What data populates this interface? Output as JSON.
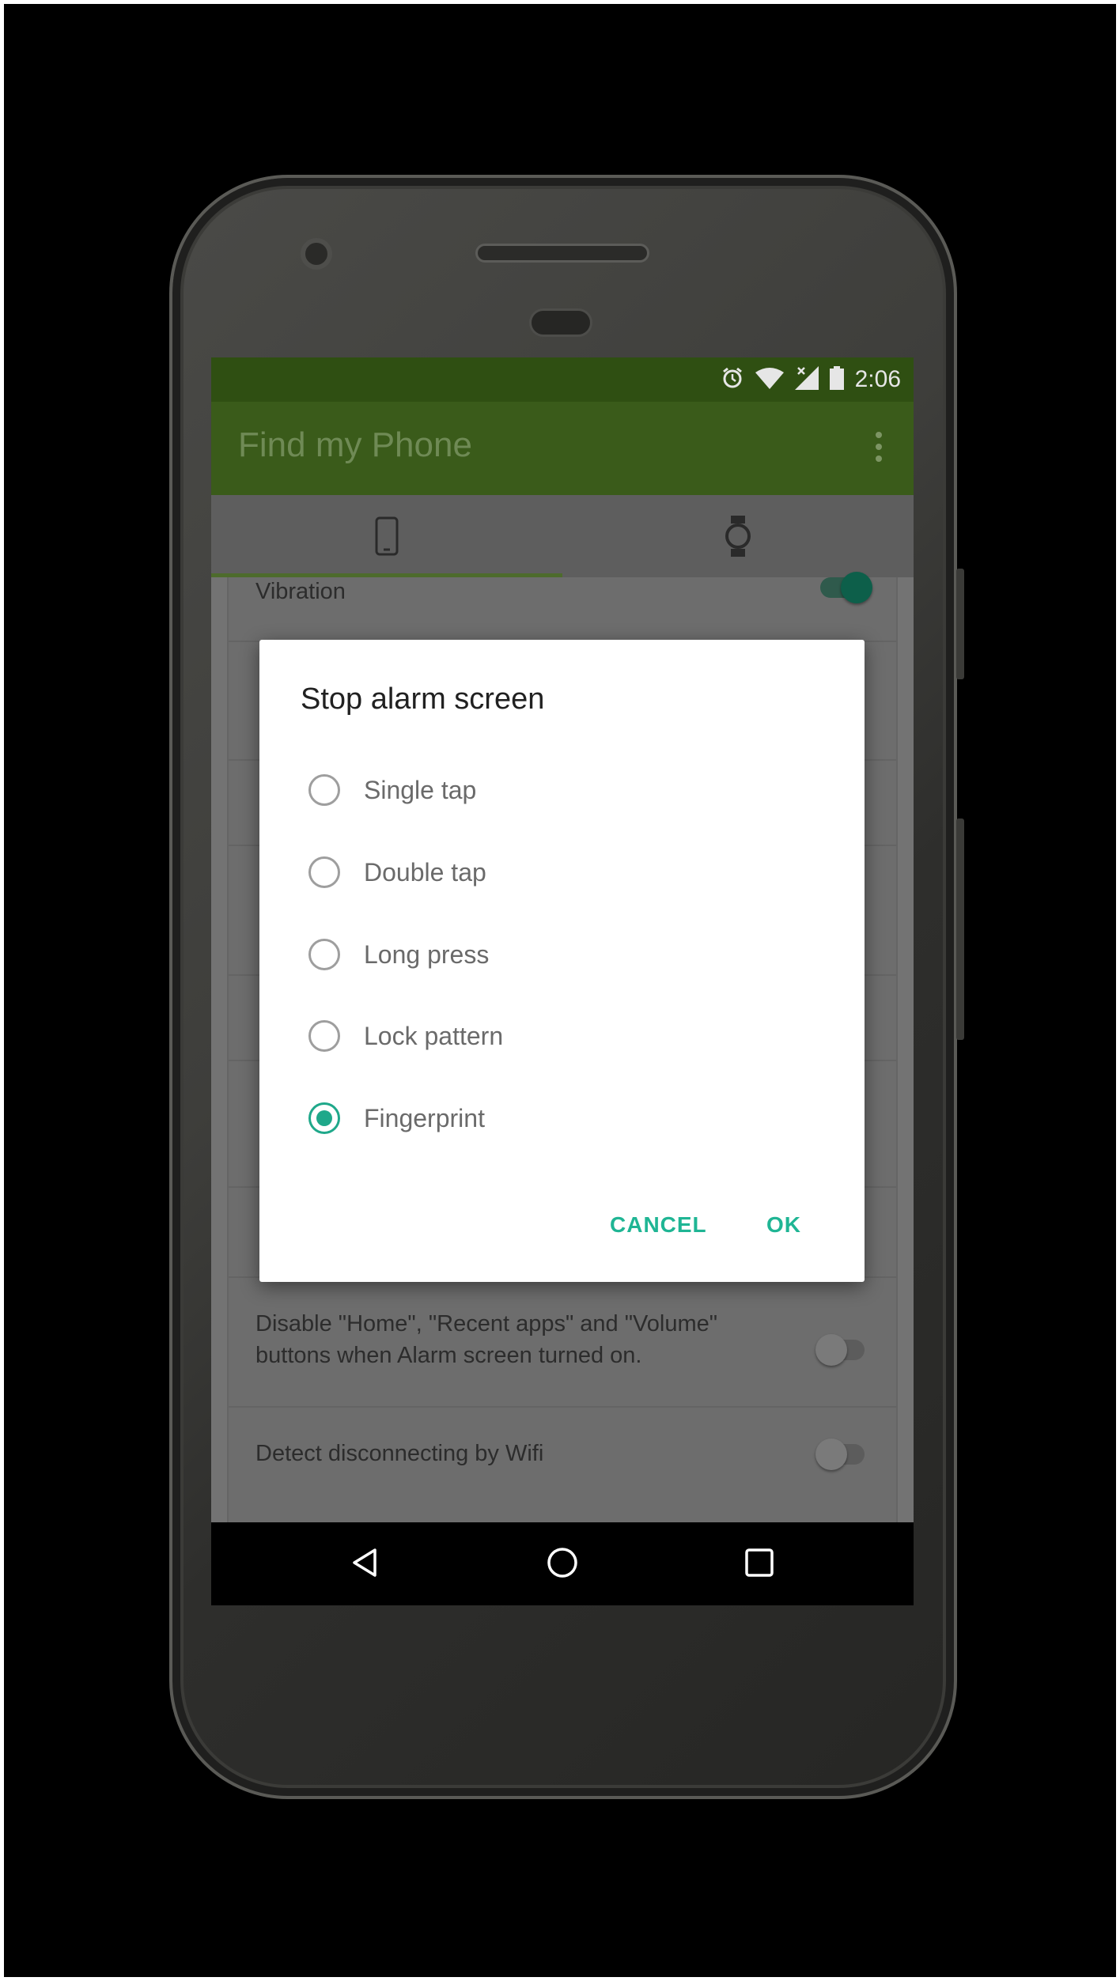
{
  "status_bar": {
    "time": "2:06",
    "icons": [
      "alarm-icon",
      "wifi-icon",
      "signal-icon",
      "battery-icon"
    ]
  },
  "app_bar": {
    "title": "Find my Phone",
    "menu_icon": "overflow-menu-icon"
  },
  "tabs": [
    {
      "icon": "phone-icon",
      "selected": true
    },
    {
      "icon": "watch-icon",
      "selected": false
    }
  ],
  "settings": [
    {
      "label": "Vibration",
      "toggle": true
    },
    {
      "label": "Disable \"Home\", \"Recent apps\" and \"Volume\" buttons when Alarm screen turned on.",
      "toggle": false
    },
    {
      "label": "Detect disconnecting by Wifi",
      "toggle": false
    }
  ],
  "dialog": {
    "title": "Stop alarm screen",
    "options": [
      "Single tap",
      "Double tap",
      "Long press",
      "Lock pattern",
      "Fingerprint"
    ],
    "selected": "Fingerprint",
    "cancel_label": "CANCEL",
    "ok_label": "OK"
  },
  "nav_bar": [
    "back-icon",
    "home-icon",
    "recents-icon"
  ],
  "colors": {
    "accent": "#1fb594",
    "app_bar": "#3a5b1a",
    "status_bar": "#2f4f12",
    "scrim": "#737373"
  }
}
